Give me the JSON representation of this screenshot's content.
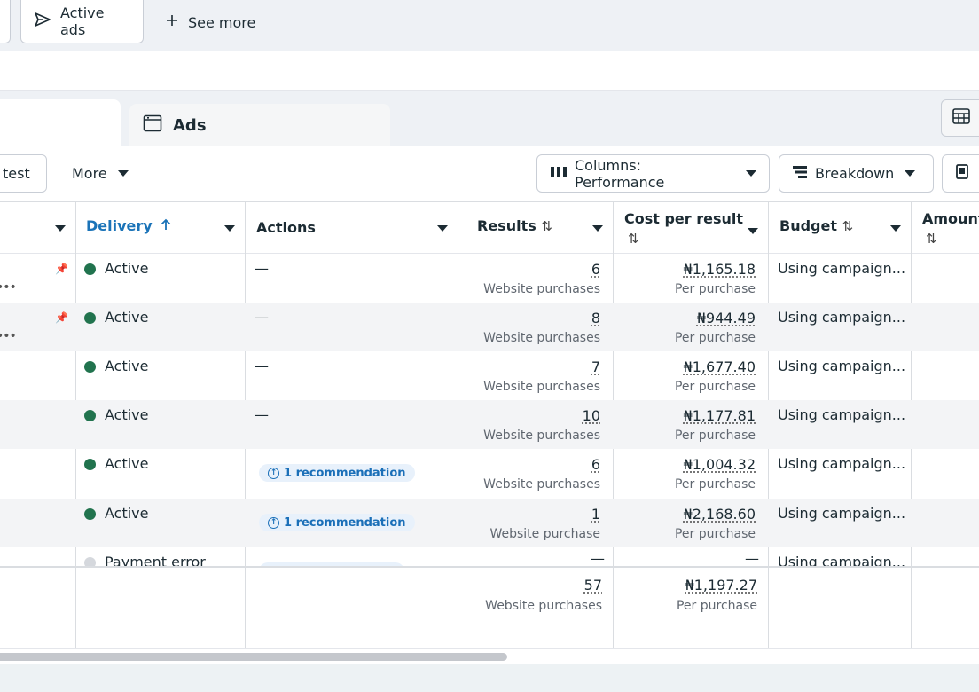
{
  "topbar": {
    "active_ads_label": "Active ads",
    "see_more_label": "See more"
  },
  "tabs": {
    "ads_label": "Ads"
  },
  "toolbar": {
    "test_label": "test",
    "more_label": "More",
    "columns_label": "Columns: Performance",
    "breakdown_label": "Breakdown"
  },
  "table": {
    "headers": {
      "delivery": "Delivery",
      "actions": "Actions",
      "results": "Results",
      "cost_per_result": "Cost per result",
      "budget": "Budget",
      "amount": "Amount"
    },
    "rows": [
      {
        "delivery": "Active",
        "actions": "—",
        "results": "6",
        "results_sub": "Website purchases",
        "cost": "₦1,165.18",
        "cost_sub": "Per purchase",
        "budget": "Using campaign..."
      },
      {
        "delivery": "Active",
        "actions": "—",
        "results": "8",
        "results_sub": "Website purchases",
        "cost": "₦944.49",
        "cost_sub": "Per purchase",
        "budget": "Using campaign..."
      },
      {
        "delivery": "Active",
        "actions": "—",
        "results": "7",
        "results_sub": "Website purchases",
        "cost": "₦1,677.40",
        "cost_sub": "Per purchase",
        "budget": "Using campaign..."
      },
      {
        "delivery": "Active",
        "actions": "—",
        "results": "10",
        "results_sub": "Website purchases",
        "cost": "₦1,177.81",
        "cost_sub": "Per purchase",
        "budget": "Using campaign..."
      },
      {
        "delivery": "Active",
        "actions": "1 recommendation",
        "results": "6",
        "results_sub": "Website purchases",
        "cost": "₦1,004.32",
        "cost_sub": "Per purchase",
        "budget": "Using campaign..."
      },
      {
        "delivery": "Active",
        "actions": "1 recommendation",
        "results": "1",
        "results_sub": "Website purchase",
        "cost": "₦2,168.60",
        "cost_sub": "Per purchase",
        "budget": "Using campaign..."
      },
      {
        "delivery": "Payment error",
        "actions": "",
        "results": "—",
        "results_sub": "",
        "cost": "—",
        "cost_sub": "",
        "budget": "Using campaign..."
      }
    ],
    "summary": {
      "results": "57",
      "results_sub": "Website purchases",
      "cost": "₦1,197.27",
      "cost_sub": "Per purchase"
    }
  },
  "colors": {
    "active_dot": "#21734e",
    "error_dot": "#d5d8dd",
    "accent_blue": "#1a6fb8",
    "delivery_header": "#1a73b8"
  }
}
